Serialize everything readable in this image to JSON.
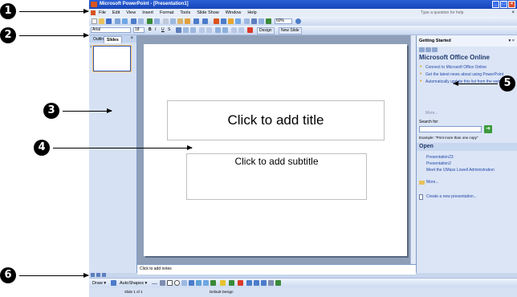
{
  "window": {
    "title": "Microsoft PowerPoint - [Presentation1]",
    "controls": [
      "_",
      "□",
      "×"
    ]
  },
  "menubar": {
    "items": [
      "File",
      "Edit",
      "View",
      "Insert",
      "Format",
      "Tools",
      "Slide Show",
      "Window",
      "Help"
    ],
    "help_placeholder": "Type a question for help",
    "close": "×"
  },
  "toolbar": {
    "zoom": "60%",
    "font_name": "Arial",
    "font_size": "18",
    "design_label": "Design",
    "new_slide_label": "New Slide",
    "bold": "B",
    "italic": "I",
    "underline": "U",
    "shadow": "S"
  },
  "left_pane": {
    "tabs": [
      "Outline",
      "Slides"
    ],
    "close": "×",
    "slide_number": "1"
  },
  "slide": {
    "title_placeholder": "Click to add title",
    "subtitle_placeholder": "Click to add subtitle"
  },
  "notes": {
    "placeholder": "Click to add notes"
  },
  "task_pane": {
    "header": "Getting Started",
    "close": "▾ ×",
    "online_title": "Microsoft Office Online",
    "links": [
      "Connect to Microsoft Office Online",
      "Get the latest news about using PowerPoint",
      "Automatically update this list from the web"
    ],
    "more": "More...",
    "search_label": "Search for:",
    "search_example": "Example: \"Print more than one copy\"",
    "open_header": "Open",
    "open_items": [
      "Presentation23",
      "Presentation2",
      "Meet the UMass Lowell Administration"
    ],
    "open_more": "More...",
    "create_new": "Create a new presentation...",
    "go": "➔"
  },
  "drawing_toolbar": {
    "draw_label": "Draw ▾",
    "autoshapes_label": "AutoShapes ▾"
  },
  "statusbar": {
    "slide_info": "Slide 1 of 1",
    "design": "Default Design"
  },
  "callouts": [
    "1",
    "2",
    "3",
    "4",
    "5",
    "6"
  ],
  "colors": {
    "title_bar": "#1846b9",
    "callout": "#000000",
    "workspace": "#8f9fb8",
    "link": "#2447a7"
  }
}
